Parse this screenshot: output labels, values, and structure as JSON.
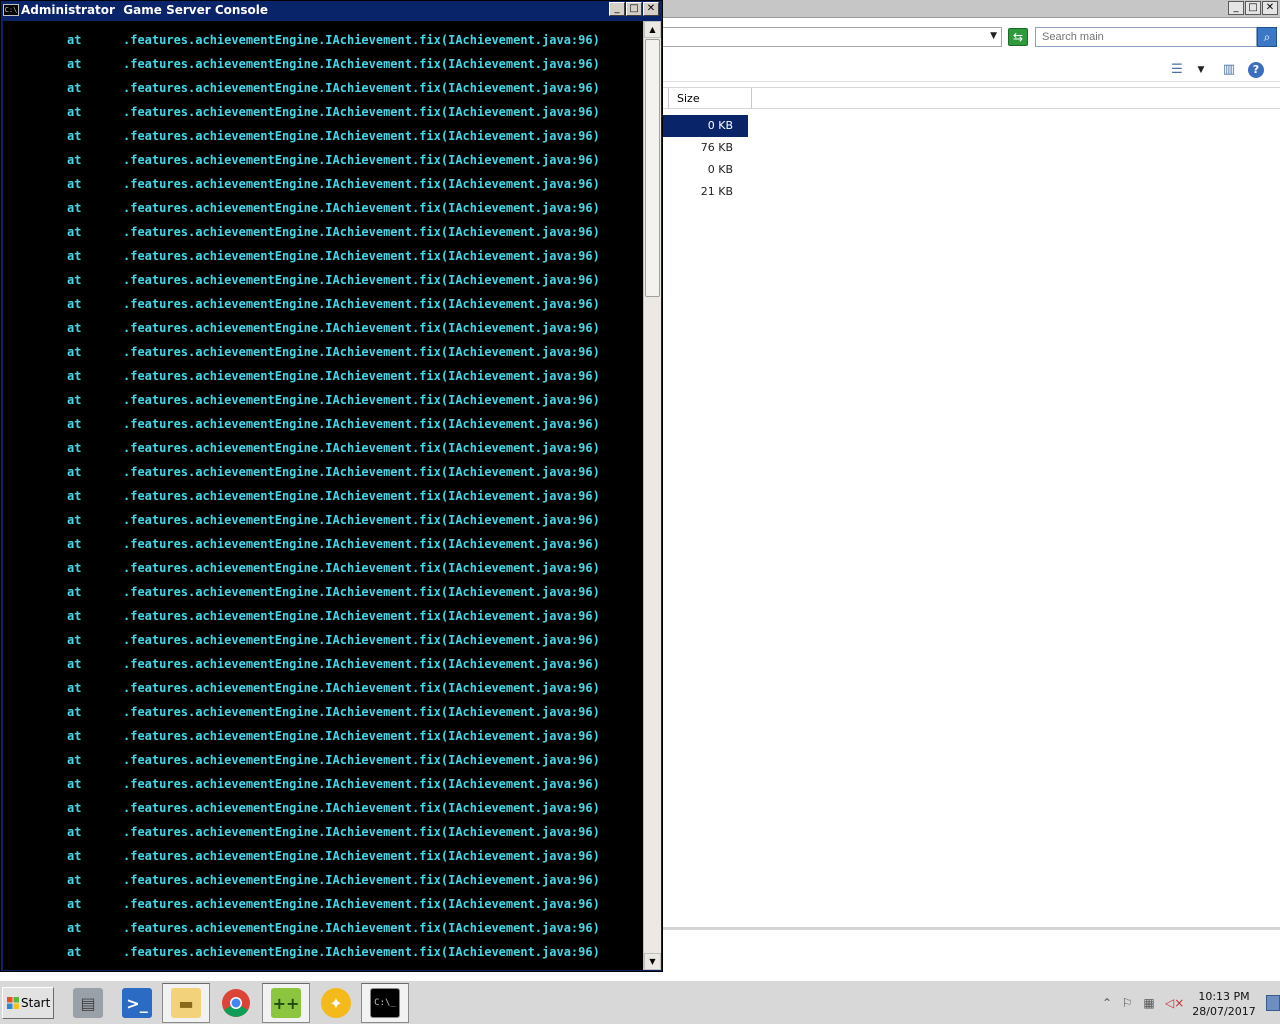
{
  "explorer": {
    "search": {
      "placeholder": "Search main",
      "icon": "search-icon"
    },
    "columns": {
      "size": "Size"
    },
    "rows": [
      {
        "size": "0 KB",
        "selected": true
      },
      {
        "size": "76 KB",
        "selected": false
      },
      {
        "size": "0 KB",
        "selected": false
      },
      {
        "size": "21 KB",
        "selected": false
      }
    ],
    "window_buttons": [
      "_",
      "□",
      "✕"
    ]
  },
  "console": {
    "title": "Administrator  Game Server Console",
    "icon_label": "C:\\",
    "line_prefix": "at",
    "line_text": ".features.achievementEngine.IAchievement.fix(IAchievement.java:96)",
    "line_count": 39,
    "text_color": "#44d8e8",
    "window_buttons": [
      "_",
      "□",
      "✕"
    ]
  },
  "taskbar": {
    "start_label": "Start",
    "apps": [
      {
        "name": "server-manager-icon"
      },
      {
        "name": "powershell-icon"
      },
      {
        "name": "file-explorer-icon"
      },
      {
        "name": "chrome-icon"
      },
      {
        "name": "notepad-plus-icon"
      },
      {
        "name": "filezilla-icon"
      },
      {
        "name": "command-prompt-icon"
      }
    ],
    "clock": {
      "time": "10:13 PM",
      "date": "28/07/2017"
    }
  }
}
